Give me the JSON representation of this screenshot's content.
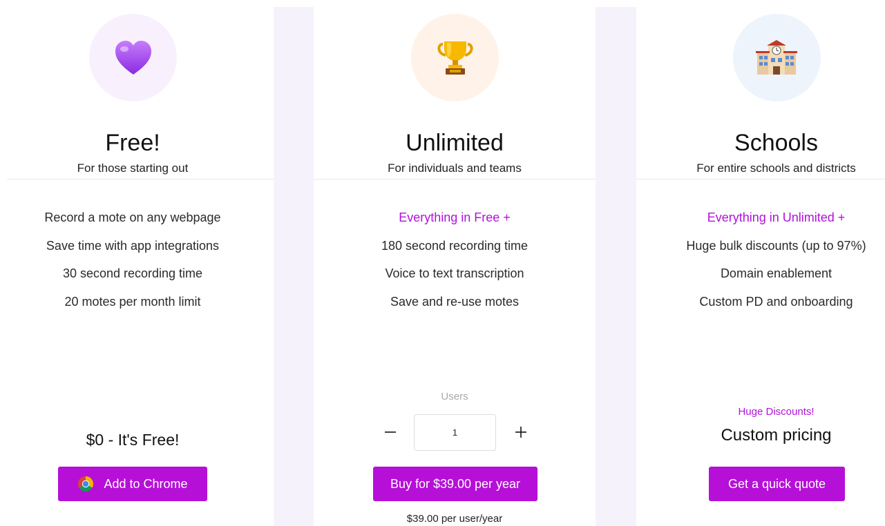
{
  "colors": {
    "accent": "#b60fd8",
    "accent_text": "#b012d9",
    "gutter": "#f6f2fb"
  },
  "plans": [
    {
      "icon": "purple-heart-icon",
      "name": "Free!",
      "subtitle": "For those starting out",
      "features": [
        "Record a mote on any webpage",
        "Save time with app integrations",
        "30 second recording time",
        "20 motes per month limit"
      ],
      "price": "$0 - It's Free!",
      "button_icon": "chrome-icon",
      "button_label": "Add to Chrome"
    },
    {
      "icon": "trophy-icon",
      "name": "Unlimited",
      "subtitle": "For individuals and teams",
      "features": [
        "Everything in Free +",
        "180 second recording time",
        "Voice to text transcription",
        "Save and re-use motes"
      ],
      "users_label": "Users",
      "users_value": "1",
      "minus_symbol": "−",
      "plus_symbol": "+",
      "button_label": "Buy for $39.00 per year",
      "per_user_note": "$39.00 per user/year"
    },
    {
      "icon": "school-building-icon",
      "name": "Schools",
      "subtitle": "For entire schools and districts",
      "features": [
        "Everything in Unlimited +",
        "Huge bulk discounts (up to 97%)",
        "Domain enablement",
        "Custom PD and onboarding"
      ],
      "discount_tag": "Huge Discounts!",
      "price": "Custom pricing",
      "button_label": "Get a quick quote"
    }
  ]
}
